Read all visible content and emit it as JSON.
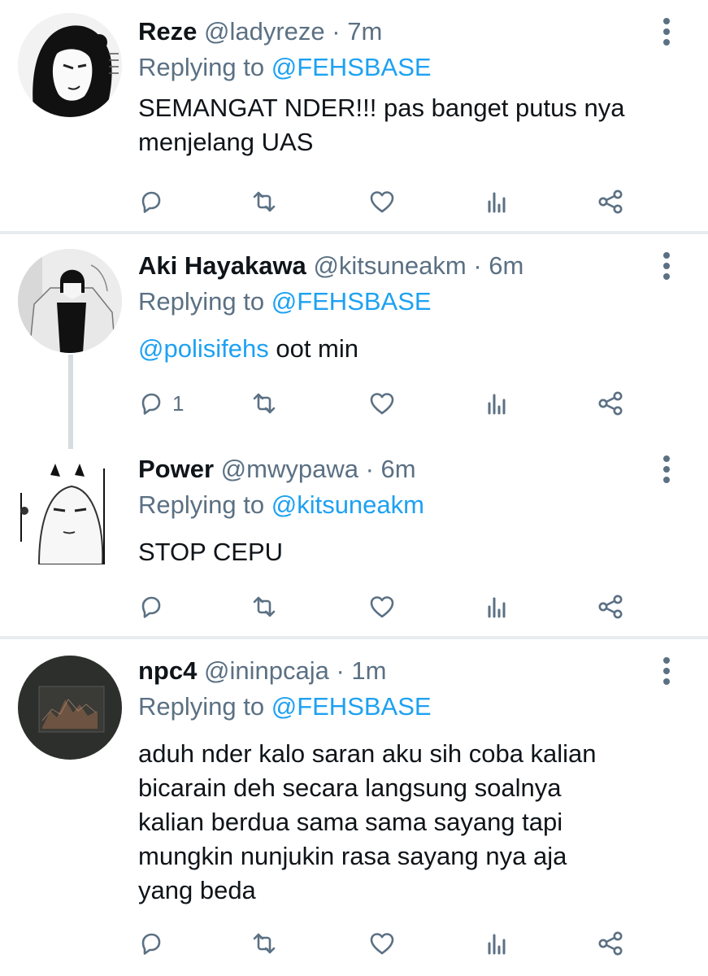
{
  "colors": {
    "link": "#1da1f2",
    "secondary": "#5b7083",
    "divider": "#e6ecf0"
  },
  "tweets": [
    {
      "name": "Reze",
      "handle": "@ladyreze",
      "sep": "·",
      "time": "7m",
      "replying_label": "Replying to",
      "replying_to": "@FEHSBASE",
      "text_lines": [
        "SEMANGAT NDER!!! pas banget putus nya",
        "menjelang UAS"
      ],
      "reply_count": ""
    },
    {
      "name": "Aki Hayakawa",
      "handle": "@kitsuneakm",
      "sep": "·",
      "time": "6m",
      "replying_label": "Replying to",
      "replying_to": "@FEHSBASE",
      "mention": "@polisifehs",
      "text": "oot min",
      "reply_count": "1"
    },
    {
      "name": "Power",
      "handle": "@mwypawa",
      "sep": "·",
      "time": "6m",
      "replying_label": "Replying to",
      "replying_to": "@kitsuneakm",
      "text_lines": [
        "STOP CEPU"
      ],
      "reply_count": ""
    },
    {
      "name": "npc4",
      "handle": "@ininpcaja",
      "sep": "·",
      "time": "1m",
      "replying_label": "Replying to",
      "replying_to": "@FEHSBASE",
      "text_lines": [
        "aduh nder kalo saran aku sih coba kalian",
        "bicarain deh secara langsung soalnya",
        "kalian berdua sama sama sayang tapi",
        "mungkin nunjukin rasa sayang nya aja",
        "yang beda"
      ],
      "reply_count": ""
    }
  ],
  "icons": [
    "reply-icon",
    "retweet-icon",
    "like-icon",
    "analytics-icon",
    "share-icon",
    "more-options-icon"
  ]
}
